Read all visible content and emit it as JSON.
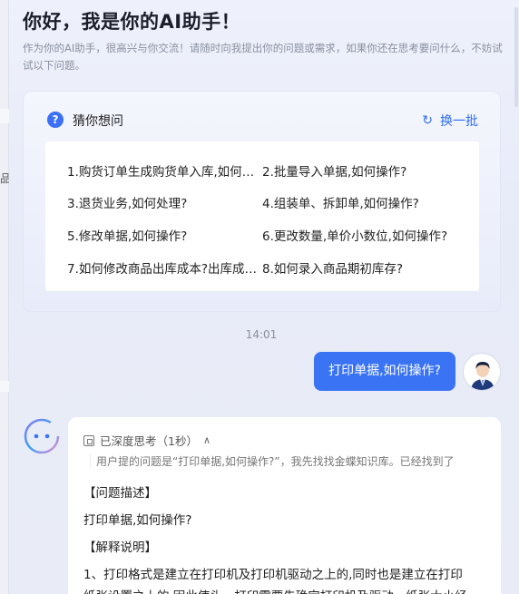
{
  "edge": {
    "char": "品"
  },
  "greeting": {
    "title": "你好，我是你的AI助手！",
    "subtitle": "作为你的AI助手，很高兴与你交流！请随时向我提出你的问题或需求，如果你还在思考要问什么，不妨试试以下问题。"
  },
  "guess": {
    "title": "猜你想问",
    "refresh_label": "换一批",
    "questions": [
      "1.购货订单生成购货单入库,如何…",
      "2.批量导入单据,如何操作?",
      "3.退货业务,如何处理?",
      "4.组装单、拆卸单,如何操作?",
      "5.修改单据,如何操作?",
      "6.更改数量,单价小数位,如何操作?",
      "7.如何修改商品出库成本?出库成…",
      "8.如何录入商品期初库存?"
    ]
  },
  "chat": {
    "time": "14:01",
    "user_message": "打印单据,如何操作?",
    "thinking_label": "已深度思考（1秒）",
    "thinking_text": "用户提的问题是“打印单据,如何操作?”，我先找找金蝶知识库。已经找到了",
    "answer_lines": [
      "【问题描述】",
      "打印单据,如何操作?",
      "【解释说明】",
      "1、打印格式是建立在打印机及打印机驱动之上的,同时也是建立在打印",
      "纸张设置之上的,因此使头一打印需要先确定打印机及驱动，纸张大小经"
    ]
  },
  "colors": {
    "accent": "#3a74f5",
    "link": "#2f6bf2"
  }
}
